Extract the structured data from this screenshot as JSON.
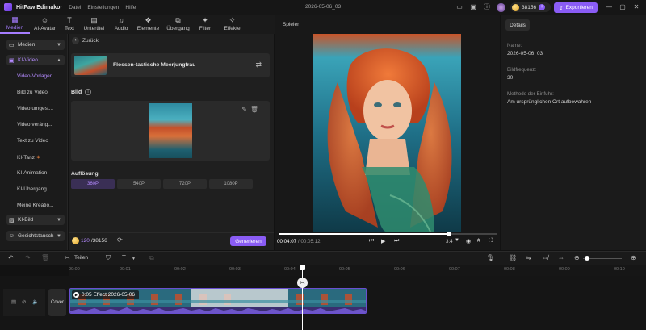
{
  "app": {
    "name": "HitPaw Edimakor",
    "menus": [
      "Datei",
      "Einstellungen",
      "Hilfe"
    ],
    "project": "2026-05-06_03",
    "credits": "38156",
    "export_label": "Exportieren"
  },
  "toolbar": [
    {
      "label": "Medien",
      "icon": "media-icon",
      "glyph": "▦"
    },
    {
      "label": "AI-Avatar",
      "icon": "avatar-icon",
      "glyph": "☺"
    },
    {
      "label": "Text",
      "icon": "text-icon",
      "glyph": "T"
    },
    {
      "label": "Untertitel",
      "icon": "subtitle-icon",
      "glyph": "▤"
    },
    {
      "label": "Audio",
      "icon": "audio-icon",
      "glyph": "♫"
    },
    {
      "label": "Elemente",
      "icon": "elements-icon",
      "glyph": "❖"
    },
    {
      "label": "Übergang",
      "icon": "transition-icon",
      "glyph": "⧉"
    },
    {
      "label": "Filter",
      "icon": "filter-icon",
      "glyph": "✦"
    },
    {
      "label": "Effekte",
      "icon": "effects-icon",
      "glyph": "✧"
    }
  ],
  "nav": {
    "medien": "Medien",
    "ki_video": "KI-Video",
    "subitems": [
      "Video-Vorlagen",
      "Bild zu Video",
      "Video umgest...",
      "Video veräng...",
      "Text zu Video",
      "KI-Tanz",
      "KI-Animation",
      "KI-Übergang",
      "Meine Kreatio..."
    ],
    "ki_bild": "KI-Bild",
    "gesichtstausch": "Gesichtstausch"
  },
  "panel": {
    "back": "Zurück",
    "template_title": "Flossen-tastische Meerjungfrau",
    "bild_label": "Bild",
    "aufloesung_label": "Auflösung",
    "resolutions": [
      "360P",
      "540P",
      "720P",
      "1080P"
    ],
    "credits_used": "120",
    "credits_total": "/38156",
    "generate": "Generieren"
  },
  "player": {
    "title": "Spieler",
    "time_current": "00:04:07",
    "time_total": "00:05:12",
    "ratio": "3:4",
    "progress": 0.78
  },
  "details": {
    "tab": "Details",
    "name_label": "Name:",
    "name": "2026-05-06_03",
    "fps_label": "Bildfrequenz:",
    "fps": "30",
    "method_label": "Methode der Einfuhr:",
    "method": "Am ursprünglichen Ort aufbewahren"
  },
  "timeline": {
    "split": "Teilen",
    "ticks": [
      "00:00",
      "00:01",
      "00:02",
      "00:03",
      "00:04",
      "00:05",
      "00:06",
      "00:07",
      "00:08",
      "00:09",
      "00:10"
    ],
    "cover": "Cover",
    "clip_label": "0:05 Effect 2026-05-06"
  }
}
